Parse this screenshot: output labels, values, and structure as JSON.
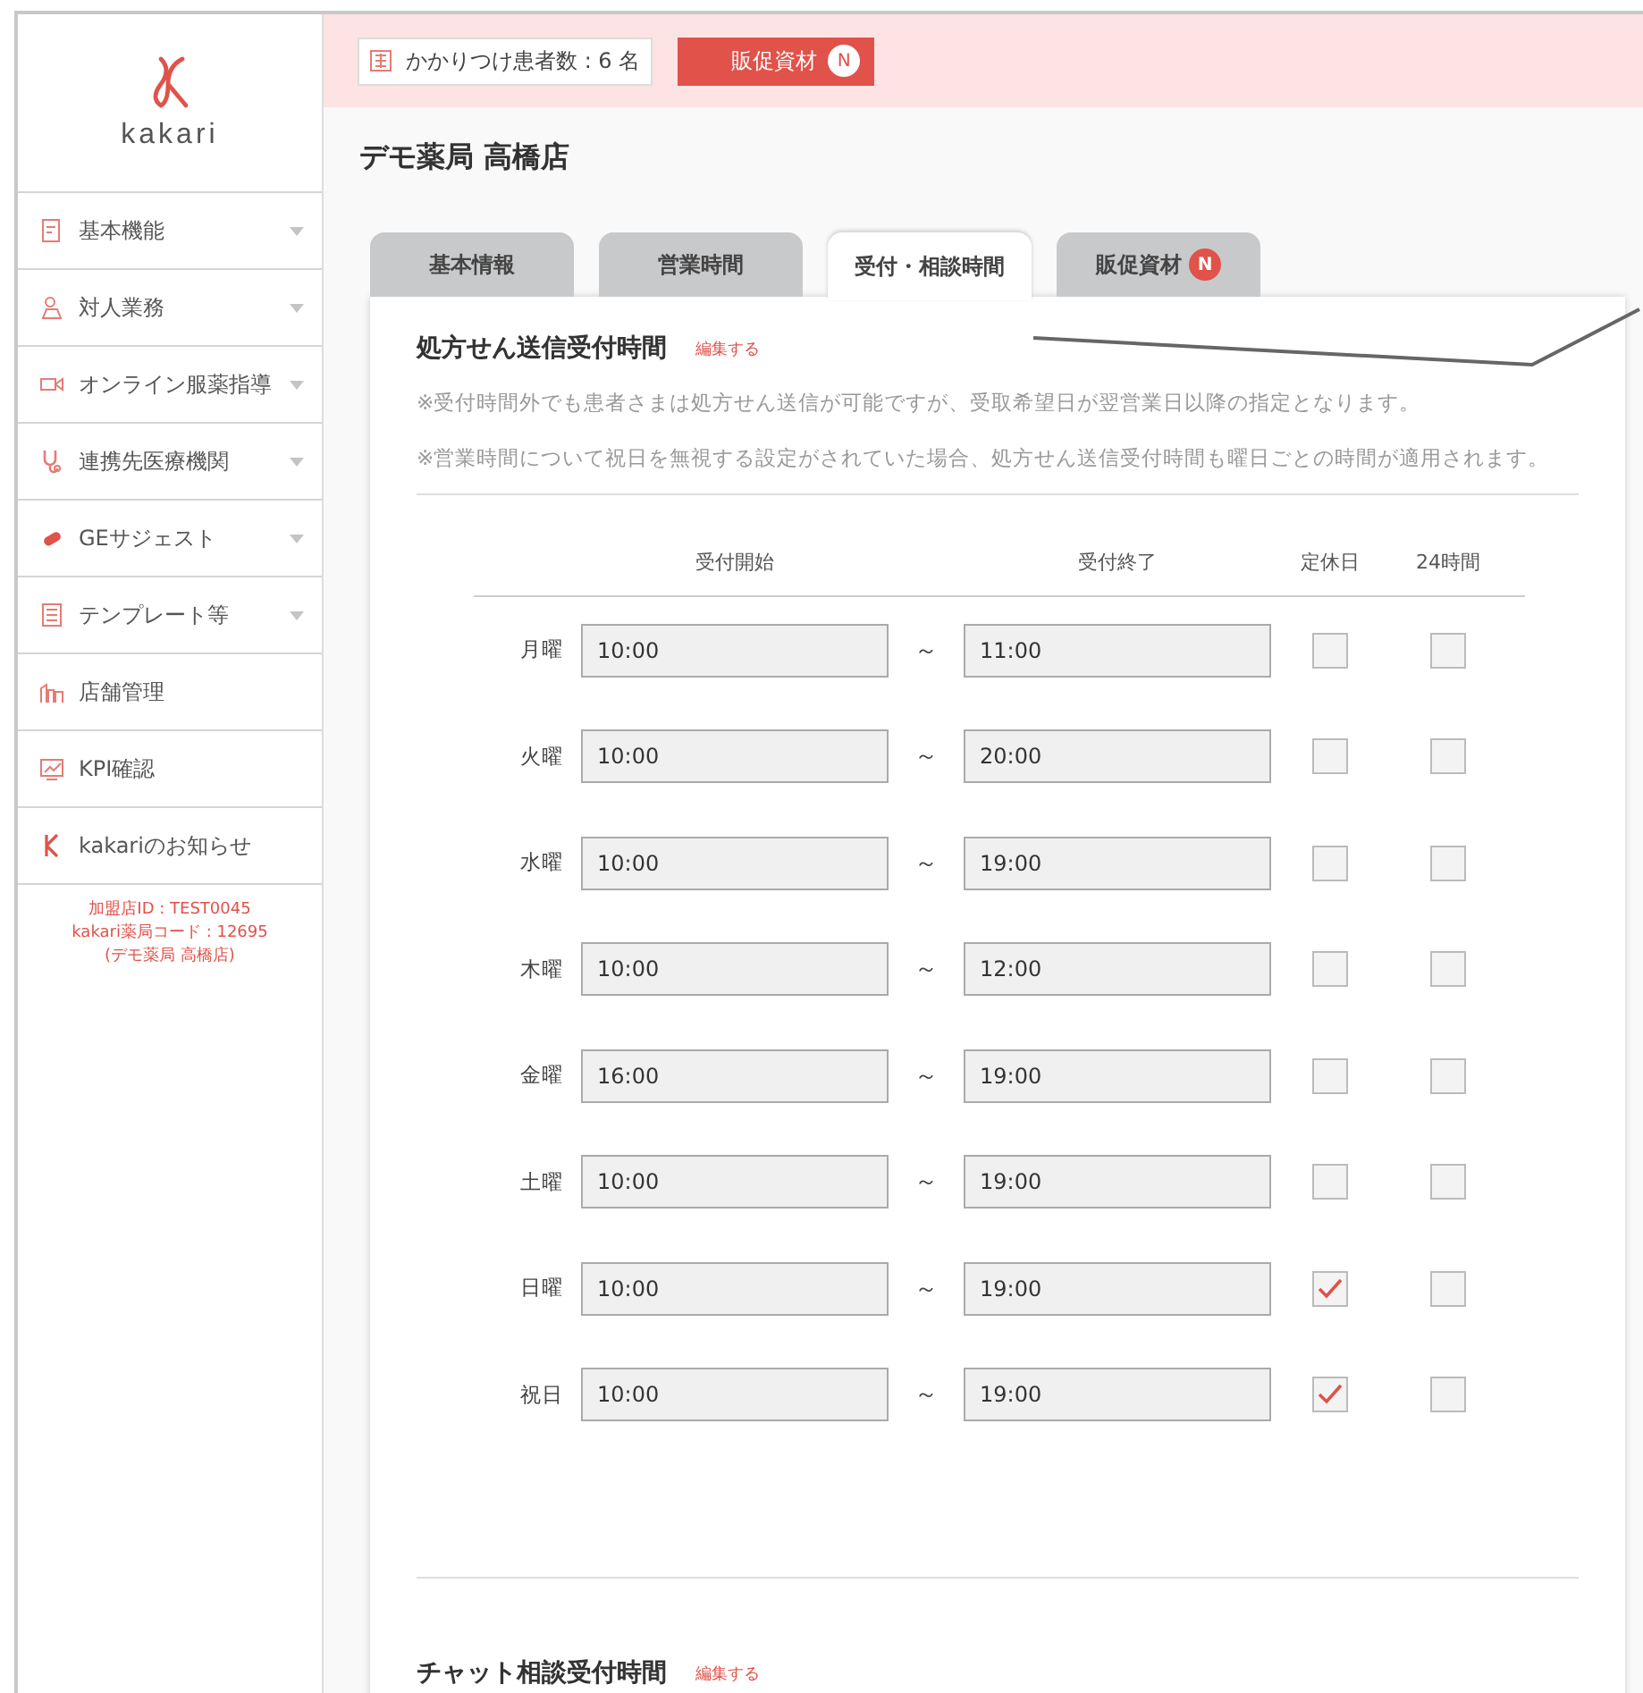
{
  "sidebar": {
    "logo_text": "kakari",
    "items": [
      {
        "label": "基本機能",
        "expandable": true
      },
      {
        "label": "対人業務",
        "expandable": true
      },
      {
        "label": "オンライン服薬指導",
        "expandable": true
      },
      {
        "label": "連携先医療機関",
        "expandable": true
      },
      {
        "label": "GEサジェスト",
        "expandable": true
      },
      {
        "label": "テンプレート等",
        "expandable": true
      },
      {
        "label": "店舗管理",
        "expandable": false
      },
      {
        "label": "KPI確認",
        "expandable": false
      },
      {
        "label": "kakariのお知らせ",
        "expandable": false
      }
    ],
    "store_info": [
      "加盟店ID : TEST0045",
      "kakari薬局コード : 12695",
      "(デモ薬局 高橋店)"
    ]
  },
  "header": {
    "patient_count": "かかりつけ患者数 : 6 名",
    "promo_button": "販促資材",
    "promo_badge": "N"
  },
  "page_title": "デモ薬局 高橋店",
  "tabs": [
    {
      "label": "基本情報",
      "selected": false
    },
    {
      "label": "営業時間",
      "selected": false
    },
    {
      "label": "受付・相談時間",
      "selected": true
    },
    {
      "label": "販促資材",
      "selected": false,
      "badge": "N"
    }
  ],
  "section": {
    "title": "処方せん送信受付時間",
    "edit_link": "編集する",
    "notes": [
      "※受付時間外でも患者さまは処方せん送信が可能ですが、受取希望日が翌営業日以降の指定となります。",
      "※営業時間について祝日を無視する設定がされていた場合、処方せん送信受付時間も曜日ごとの時間が適用されます。"
    ],
    "columns": [
      "受付開始",
      "受付終了",
      "定休日",
      "24時間"
    ],
    "separator": "～",
    "rows": [
      {
        "day": "月曜",
        "start": "10:00",
        "end": "11:00",
        "closed": false,
        "all_day": false
      },
      {
        "day": "火曜",
        "start": "10:00",
        "end": "20:00",
        "closed": false,
        "all_day": false
      },
      {
        "day": "水曜",
        "start": "10:00",
        "end": "19:00",
        "closed": false,
        "all_day": false
      },
      {
        "day": "木曜",
        "start": "10:00",
        "end": "12:00",
        "closed": false,
        "all_day": false
      },
      {
        "day": "金曜",
        "start": "16:00",
        "end": "19:00",
        "closed": false,
        "all_day": false
      },
      {
        "day": "土曜",
        "start": "10:00",
        "end": "19:00",
        "closed": false,
        "all_day": false
      },
      {
        "day": "日曜",
        "start": "10:00",
        "end": "19:00",
        "closed": true,
        "all_day": false
      },
      {
        "day": "祝日",
        "start": "10:00",
        "end": "19:00",
        "closed": true,
        "all_day": false
      }
    ]
  },
  "section2": {
    "title": "チャット相談受付時間",
    "edit_link": "編集する"
  }
}
